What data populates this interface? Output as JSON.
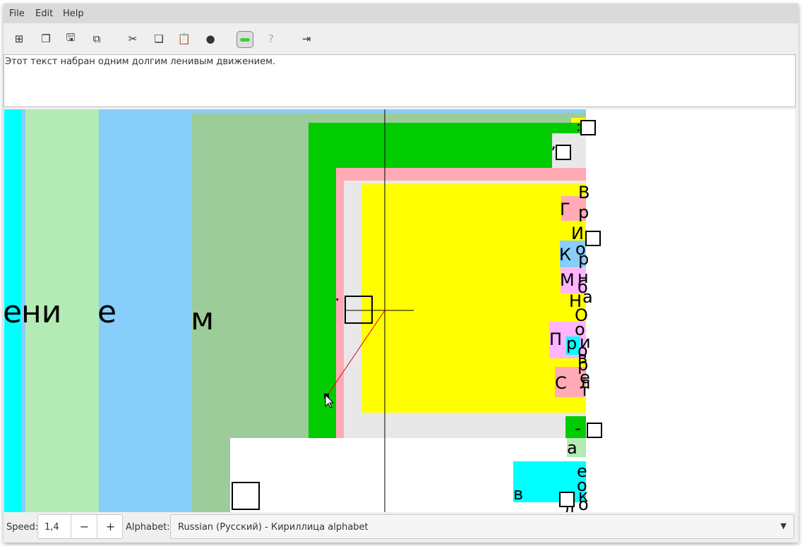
{
  "menu": [
    "File",
    "Edit",
    "Help"
  ],
  "toolbar": {
    "icons": [
      "new-file-icon",
      "copy-window-icon",
      "save-icon",
      "save-as-icon",
      "cut-icon",
      "copy-icon",
      "paste-icon",
      "globe-icon",
      "toggle-icon",
      "help-icon",
      "exit-icon"
    ],
    "help_glyph": "?"
  },
  "text_output": "Этот текст набран одним долгим ленивым движением.",
  "canvas": {
    "big_letters": [
      "е",
      "ни",
      "е",
      "м"
    ],
    "letters": [
      "В",
      "Г",
      "р",
      "И",
      "К",
      "о",
      "р",
      "М",
      "н",
      "б",
      "а",
      "Н",
      "О",
      "о",
      "П",
      "р",
      "и",
      "о",
      "в",
      "р",
      "С",
      "е",
      "л",
      "т",
      "а",
      "е",
      "о",
      "в",
      "к",
      "о",
      "д",
      ":",
      "’",
      "-"
    ]
  },
  "bottom": {
    "speed_label": "Speed:",
    "speed_value": "1,4",
    "minus": "−",
    "plus": "+",
    "alphabet_label": "Alphabet:",
    "alphabet_value": "Russian (Русский) - Кириллица alphabet"
  }
}
